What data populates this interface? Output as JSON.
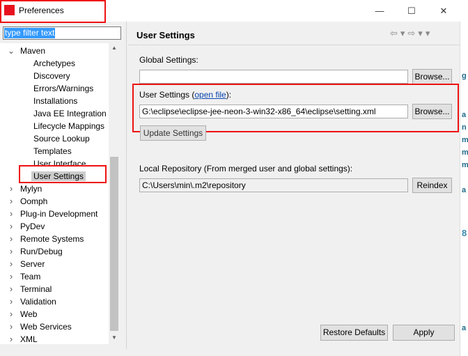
{
  "window": {
    "title": "Preferences",
    "controls": [
      "—",
      "☐",
      "✕"
    ]
  },
  "filter": {
    "placeholder": "type filter text"
  },
  "tree": {
    "maven_label": "Maven",
    "maven_children": [
      "Archetypes",
      "Discovery",
      "Errors/Warnings",
      "Installations",
      "Java EE Integration",
      "Lifecycle Mappings",
      "Source Lookup",
      "Templates",
      "User Interface",
      "User Settings"
    ],
    "selected": "User Settings",
    "collapsed_items": [
      "Mylyn",
      "Oomph",
      "Plug-in Development",
      "PyDev",
      "Remote Systems",
      "Run/Debug",
      "Server",
      "Team",
      "Terminal",
      "Validation",
      "Web",
      "Web Services",
      "XML"
    ]
  },
  "page": {
    "title": "User Settings",
    "global_settings_label": "Global Settings:",
    "global_settings_value": "",
    "global_browse": "Browse...",
    "user_settings_label_prefix": "User Settings (",
    "user_settings_link": "open file",
    "user_settings_label_suffix": "):",
    "user_settings_value": "G:\\eclipse\\eclipse-jee-neon-3-win32-x86_64\\eclipse\\setting.xml",
    "user_browse": "Browse...",
    "update_settings": "Update Settings",
    "local_repo_label": "Local Repository (From merged user and global settings):",
    "local_repo_value": "C:\\Users\\min\\.m2\\repository",
    "reindex": "Reindex",
    "restore_defaults": "Restore Defaults",
    "apply": "Apply"
  },
  "colors": {
    "accent": "#3399ff",
    "highlight_box": "#ee1111",
    "app_icon": "#e8111e"
  }
}
